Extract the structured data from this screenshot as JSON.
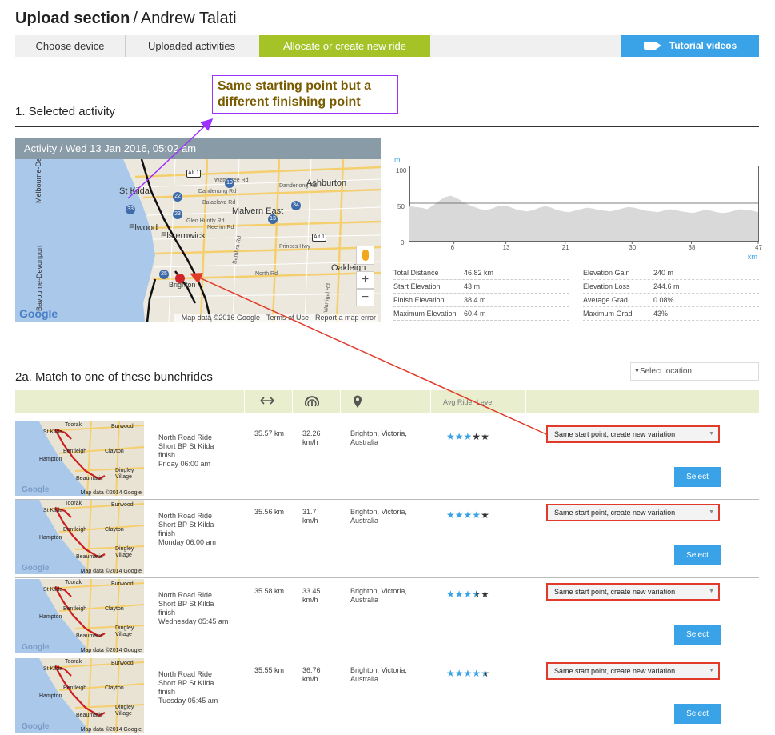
{
  "header": {
    "section": "Upload section",
    "separator": "/",
    "user": "Andrew Talati"
  },
  "tabs": [
    {
      "label": "Choose device"
    },
    {
      "label": "Uploaded activities"
    },
    {
      "label": "Allocate or create new ride"
    }
  ],
  "tutorial": {
    "label": "Tutorial videos",
    "icon": "video-camera-icon"
  },
  "colors": {
    "accent": "#a5c226",
    "blue": "#3aa3e8",
    "callout": "#9b30ff",
    "highlight": "#e03a2a"
  },
  "annotation": {
    "text_line1": "Same starting point but a",
    "text_line2": "different finishing point"
  },
  "selected_activity": {
    "heading": "1. Selected activity",
    "map_title": "Activity / Wed 13 Jan 2016, 05:02 am",
    "map": {
      "labels": [
        "St Kilda",
        "Elwood",
        "Elsternwick",
        "Malvern East",
        "Ashburton",
        "Oakleigh",
        "Brighton",
        "Melbourne-Devonport",
        "Bavoume-Devonport"
      ],
      "street_labels": [
        "Wattletree Rd",
        "Dandenong Rd",
        "Balaclava Rd",
        "Glen Huntly Rd",
        "Neerim Rd",
        "North Rd",
        "Bambra Rd",
        "Warrigal Rd",
        "Princes Hwy",
        "Dandenong Rd"
      ],
      "route_badges": [
        "Alt 1",
        "19",
        "22",
        "23",
        "25",
        "33",
        "34",
        "Alt 1",
        "13"
      ],
      "logo": "Google",
      "attribution": [
        "Map data ©2016 Google",
        "Terms of Use",
        "Report a map error"
      ],
      "zoom_in": "+",
      "zoom_out": "−"
    },
    "elevation": {
      "y_unit": "m",
      "x_unit": "km",
      "y_ticks": [
        "100",
        "50",
        "0"
      ],
      "x_ticks": [
        "6",
        "13",
        "21",
        "30",
        "38",
        "47"
      ],
      "profile": [
        46,
        45,
        44,
        42,
        47,
        53,
        58,
        60,
        57,
        52,
        48,
        45,
        42,
        41,
        43,
        46,
        47,
        45,
        42,
        40,
        39,
        41,
        44,
        46,
        44,
        41,
        39,
        38,
        40,
        42,
        44,
        43,
        41,
        40,
        39,
        41,
        43,
        45,
        44,
        42,
        40,
        39,
        38,
        40,
        42,
        41,
        39,
        38,
        37,
        39,
        41,
        40,
        38,
        37,
        38,
        40,
        42,
        41,
        40,
        38
      ]
    },
    "stats_left": [
      {
        "k": "Total Distance",
        "v": "46.82 km"
      },
      {
        "k": "Start Elevation",
        "v": "43 m"
      },
      {
        "k": "Finish Elevation",
        "v": "38.4 m"
      },
      {
        "k": "Maximum Elevation",
        "v": "60.4 m"
      }
    ],
    "stats_right": [
      {
        "k": "Elevation Gain",
        "v": "240 m"
      },
      {
        "k": "Elevation Loss",
        "v": "244.6 m"
      },
      {
        "k": "Average Grad",
        "v": "0.08%"
      },
      {
        "k": "Maximum Grad",
        "v": "43%"
      }
    ]
  },
  "bunchrides": {
    "heading": "2a. Match to one of these bunchrides",
    "location_placeholder": "Select location",
    "columns": {
      "distance_icon": "distance-arrows-icon",
      "speed_icon": "speedometer-icon",
      "location_icon": "location-pin-icon",
      "level": "Avg Rider Level"
    },
    "thumb": {
      "logo": "Google",
      "attribution": "Map data ©2014 Google",
      "labels": [
        "Toorak",
        "Burwood",
        "St Kilda",
        "Bentleigh",
        "Clayton",
        "Hampton",
        "Dingley Village",
        "Beaumaris"
      ]
    },
    "variation_option": "Same start point, create new variation",
    "select_label": "Select",
    "rows": [
      {
        "name": "North Road Ride",
        "sub1": "Short BP St Kilda",
        "sub2": "finish",
        "when": "Friday 06:00 am",
        "distance": "35.57 km",
        "speed1": "32.26",
        "speed2": "km/h",
        "loc1": "Brighton, Victoria,",
        "loc2": "Australia",
        "rating": 3,
        "max": 5
      },
      {
        "name": "North Road Ride",
        "sub1": "Short BP St Kilda",
        "sub2": "finish",
        "when": "Monday 06:00 am",
        "distance": "35.56 km",
        "speed1": "31.7",
        "speed2": "km/h",
        "loc1": "Brighton, Victoria,",
        "loc2": "Australia",
        "rating": 4,
        "max": 5
      },
      {
        "name": "North Road Ride",
        "sub1": "Short BP St Kilda",
        "sub2": "finish",
        "when": "Wednesday 05:45 am",
        "distance": "35.58 km",
        "speed1": "33.45",
        "speed2": "km/h",
        "loc1": "Brighton, Victoria,",
        "loc2": "Australia",
        "rating": 3.5,
        "max": 5
      },
      {
        "name": "North Road Ride",
        "sub1": "Short BP St Kilda",
        "sub2": "finish",
        "when": "Tuesday 05:45 am",
        "distance": "35.55 km",
        "speed1": "36.76",
        "speed2": "km/h",
        "loc1": "Brighton, Victoria,",
        "loc2": "Australia",
        "rating": 4.5,
        "max": 5
      }
    ]
  }
}
